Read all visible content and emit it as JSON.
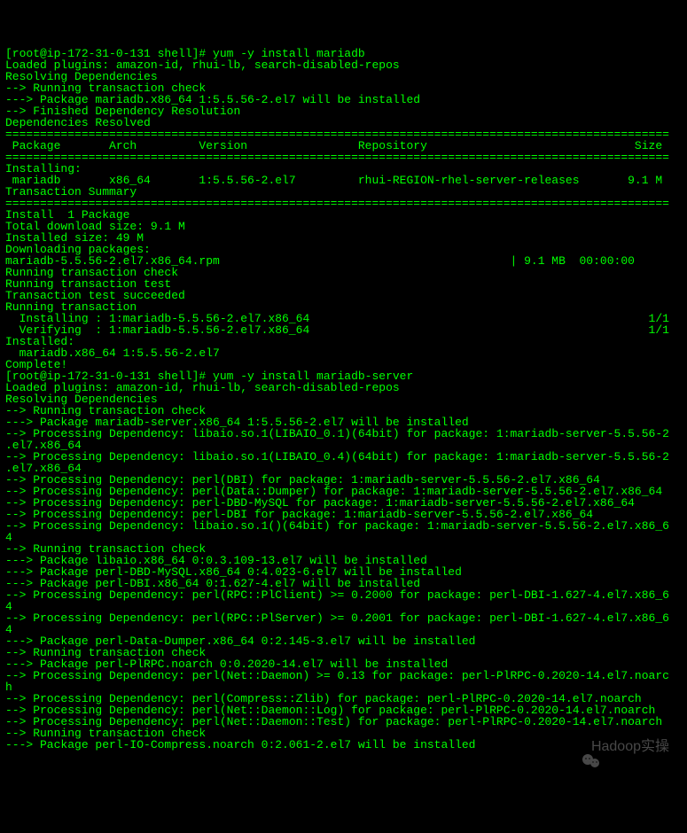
{
  "terminal": {
    "lines": [
      "[root@ip-172-31-0-131 shell]# yum -y install mariadb",
      "Loaded plugins: amazon-id, rhui-lb, search-disabled-repos",
      "Resolving Dependencies",
      "--> Running transaction check",
      "---> Package mariadb.x86_64 1:5.5.56-2.el7 will be installed",
      "--> Finished Dependency Resolution",
      "",
      "Dependencies Resolved",
      "",
      "================================================================================================",
      " Package       Arch         Version                Repository                              Size",
      "================================================================================================",
      "Installing:",
      " mariadb       x86_64       1:5.5.56-2.el7         rhui-REGION-rhel-server-releases       9.1 M",
      "",
      "Transaction Summary",
      "================================================================================================",
      "Install  1 Package",
      "",
      "Total download size: 9.1 M",
      "Installed size: 49 M",
      "Downloading packages:",
      "mariadb-5.5.56-2.el7.x86_64.rpm                                          | 9.1 MB  00:00:00",
      "Running transaction check",
      "Running transaction test",
      "Transaction test succeeded",
      "Running transaction",
      "  Installing : 1:mariadb-5.5.56-2.el7.x86_64                                                 1/1",
      "  Verifying  : 1:mariadb-5.5.56-2.el7.x86_64                                                 1/1",
      "",
      "Installed:",
      "  mariadb.x86_64 1:5.5.56-2.el7",
      "",
      "Complete!",
      "[root@ip-172-31-0-131 shell]# yum -y install mariadb-server",
      "Loaded plugins: amazon-id, rhui-lb, search-disabled-repos",
      "Resolving Dependencies",
      "--> Running transaction check",
      "---> Package mariadb-server.x86_64 1:5.5.56-2.el7 will be installed",
      "--> Processing Dependency: libaio.so.1(LIBAIO_0.1)(64bit) for package: 1:mariadb-server-5.5.56-2",
      ".el7.x86_64",
      "--> Processing Dependency: libaio.so.1(LIBAIO_0.4)(64bit) for package: 1:mariadb-server-5.5.56-2",
      ".el7.x86_64",
      "--> Processing Dependency: perl(DBI) for package: 1:mariadb-server-5.5.56-2.el7.x86_64",
      "--> Processing Dependency: perl(Data::Dumper) for package: 1:mariadb-server-5.5.56-2.el7.x86_64",
      "--> Processing Dependency: perl-DBD-MySQL for package: 1:mariadb-server-5.5.56-2.el7.x86_64",
      "--> Processing Dependency: perl-DBI for package: 1:mariadb-server-5.5.56-2.el7.x86_64",
      "--> Processing Dependency: libaio.so.1()(64bit) for package: 1:mariadb-server-5.5.56-2.el7.x86_6",
      "4",
      "--> Running transaction check",
      "---> Package libaio.x86_64 0:0.3.109-13.el7 will be installed",
      "---> Package perl-DBD-MySQL.x86_64 0:4.023-6.el7 will be installed",
      "---> Package perl-DBI.x86_64 0:1.627-4.el7 will be installed",
      "--> Processing Dependency: perl(RPC::PlClient) >= 0.2000 for package: perl-DBI-1.627-4.el7.x86_6",
      "4",
      "--> Processing Dependency: perl(RPC::PlServer) >= 0.2001 for package: perl-DBI-1.627-4.el7.x86_6",
      "4",
      "---> Package perl-Data-Dumper.x86_64 0:2.145-3.el7 will be installed",
      "--> Running transaction check",
      "---> Package perl-PlRPC.noarch 0:0.2020-14.el7 will be installed",
      "--> Processing Dependency: perl(Net::Daemon) >= 0.13 for package: perl-PlRPC-0.2020-14.el7.noarc",
      "h",
      "--> Processing Dependency: perl(Compress::Zlib) for package: perl-PlRPC-0.2020-14.el7.noarch",
      "--> Processing Dependency: perl(Net::Daemon::Log) for package: perl-PlRPC-0.2020-14.el7.noarch",
      "--> Processing Dependency: perl(Net::Daemon::Test) for package: perl-PlRPC-0.2020-14.el7.noarch",
      "--> Running transaction check",
      "---> Package perl-IO-Compress.noarch 0:2.061-2.el7 will be installed"
    ]
  },
  "watermark": {
    "text": "Hadoop实操",
    "icon": "wechat-icon"
  }
}
